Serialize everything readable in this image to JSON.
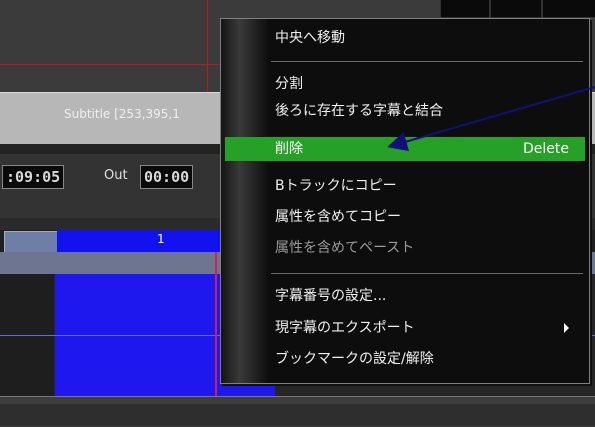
{
  "colors": {
    "selection": "#27a027",
    "clip": "#1e18ee",
    "playhead": "#d0205a",
    "annotation": "#10107a"
  },
  "track": {
    "subtitle_info": "Subtitle [253,395,1",
    "in_timecode": ":09:05",
    "out_label": "Out",
    "out_timecode": "00:00",
    "clip_number": "1"
  },
  "menu": {
    "items": [
      {
        "label": "中央へ移動",
        "enabled": true
      },
      {
        "label": "分割",
        "enabled": true
      },
      {
        "label": "後ろに存在する字幕と結合",
        "enabled": true
      },
      {
        "label": "削除",
        "shortcut": "Delete",
        "enabled": true,
        "selected": true
      },
      {
        "label": "Bトラックにコピー",
        "enabled": true
      },
      {
        "label": "属性を含めてコピー",
        "enabled": true
      },
      {
        "label": "属性を含めてペースト",
        "enabled": false
      },
      {
        "label": "字幕番号の設定...",
        "enabled": true
      },
      {
        "label": "現字幕のエクスポート",
        "enabled": true,
        "submenu": true
      },
      {
        "label": "ブックマークの設定/解除",
        "enabled": true
      }
    ]
  }
}
